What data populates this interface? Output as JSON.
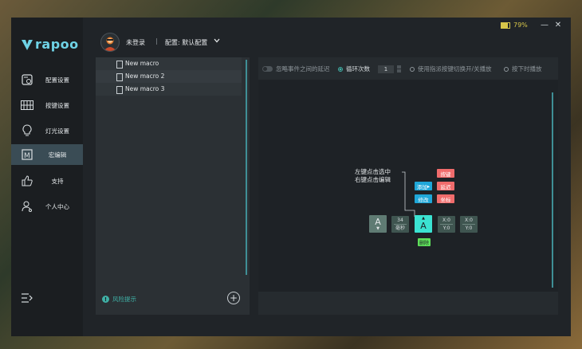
{
  "brand": {
    "logo_text": "rapoo",
    "accent": "#6fd3e6"
  },
  "sidebar": {
    "items": [
      {
        "label": "配置设置",
        "icon": "config-icon"
      },
      {
        "label": "按键设置",
        "icon": "keyboard-icon"
      },
      {
        "label": "灯光设置",
        "icon": "lightbulb-icon"
      },
      {
        "label": "宏编辑",
        "icon": "macro-icon",
        "active": true
      },
      {
        "label": "支持",
        "icon": "thumbs-up-icon"
      },
      {
        "label": "个人中心",
        "icon": "user-icon"
      }
    ],
    "collapse_icon": "menu-collapse-icon"
  },
  "header": {
    "login_status": "未登录",
    "separator": "|",
    "profile_label": "配置: 默认配置",
    "battery_percent": 79,
    "battery_text": "79%",
    "minimize_glyph": "—",
    "close_glyph": "✕"
  },
  "macros": {
    "items": [
      "New macro",
      "New macro 2",
      "New macro 3"
    ],
    "risk_label": "风险提示",
    "risk_glyph": "!",
    "add_glyph": "+"
  },
  "options": {
    "ignore_delay_label": "忽略事件之间的延迟",
    "loop_count_label": "循环次数",
    "loop_count_value": "1",
    "toggle_mode_label": "使用指派按键切换开/关播放",
    "press_play_label": "按下时播放"
  },
  "editor": {
    "tip_line1": "左键点击选中",
    "tip_line2": "右键点击编辑",
    "add_label": "添加",
    "add_arrow": "▸",
    "modify_label": "修改",
    "key_label": "按键",
    "delay_label": "延迟",
    "coord_label": "坐标",
    "key1_letter": "A",
    "key1_arrow": "▼",
    "delay_value": "34",
    "delay_unit": "毫秒",
    "key2_arrow": "▲",
    "key2_letter": "A",
    "coord1_x": "X:0",
    "coord1_y": "Y:0",
    "coord2_x": "X:0",
    "coord2_y": "Y:0",
    "delete_label": "删除"
  },
  "colors": {
    "teal": "#3fb0a6",
    "selected_key": "#3be3d2",
    "ctx_add": "#1fa7d8",
    "ctx_red": "#f06c6c",
    "delete_green": "#5ee05a"
  }
}
